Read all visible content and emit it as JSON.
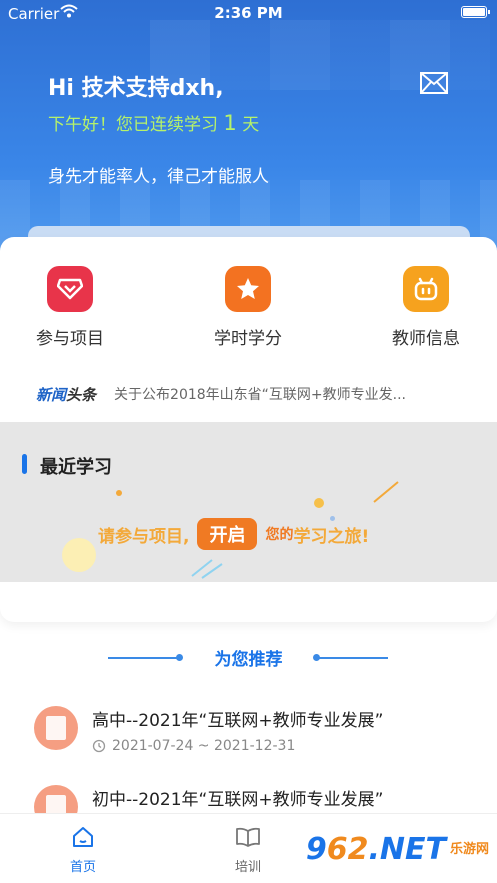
{
  "status_bar": {
    "carrier": "Carrier",
    "time": "2:36 PM"
  },
  "header": {
    "greeting": "Hi 技术支持dxh,",
    "streak_prefix": "下午好！您已连续学习",
    "streak_days": "1",
    "streak_suffix": "天",
    "motto": "身先才能率人，律己才能服人"
  },
  "features": [
    {
      "label": "参与项目",
      "color": "#e8344a"
    },
    {
      "label": "学时学分",
      "color": "#f37221"
    },
    {
      "label": "教师信息",
      "color": "#f6a21e"
    }
  ],
  "news": {
    "tag_part1": "新闻",
    "tag_part2": "头条",
    "headline": "关于公布2018年山东省“互联网+教师专业发..."
  },
  "recent": {
    "title": "最近学习",
    "cta_before": "请参与项目,",
    "cta_button": "开启",
    "cta_mid": "您的",
    "cta_after": "学习之旅!"
  },
  "recommend": {
    "title": "为您推荐",
    "courses": [
      {
        "title": "高中--2021年“互联网+教师专业发展”",
        "date": "2021-07-24 ~ 2021-12-31"
      },
      {
        "title": "初中--2021年“互联网+教师专业发展”",
        "date": ""
      }
    ]
  },
  "tabbar": {
    "home": "首页",
    "training": "培训"
  },
  "watermark": {
    "num_a": "9",
    "num_b": "62",
    "num_c": ".NET",
    "site": "乐游网"
  },
  "colors": {
    "accent": "#1a74e8",
    "streak": "#b6f26a",
    "cta": "#f07a23"
  }
}
